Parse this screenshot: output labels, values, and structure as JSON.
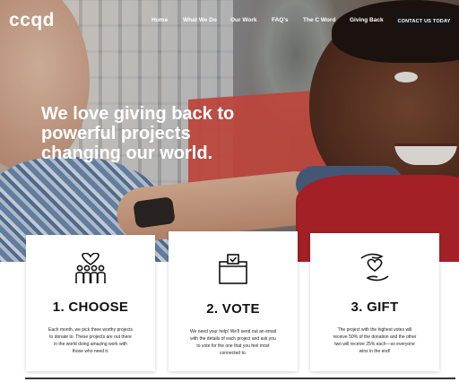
{
  "header": {
    "logo": "ccqd",
    "nav": [
      {
        "label": "Home"
      },
      {
        "label": "What We Do"
      },
      {
        "label": "Our Work"
      },
      {
        "label": "FAQ's"
      },
      {
        "label": "The C Word"
      },
      {
        "label": "Giving Back"
      }
    ],
    "cta_label": "CONTACT US TODAY"
  },
  "hero": {
    "headline": [
      "We love giving back to",
      "powerful projects",
      "changing our world."
    ]
  },
  "steps": [
    {
      "icon": "people-heart-icon",
      "title": "1. CHOOSE",
      "description": [
        "Each month, we pick three worthy projects",
        "to donate to. These projects are out there",
        "in the world doing amazing work with",
        "those who need it."
      ]
    },
    {
      "icon": "ballot-box-icon",
      "title": "2. VOTE",
      "description": [
        "We need your help! We'll send out an email",
        "with the details of each project and ask you",
        "to vote for the one that you feel most",
        "connected to."
      ]
    },
    {
      "icon": "hands-heart-icon",
      "title": "3. GIFT",
      "description": [
        "The project with the highest votes will",
        "receive 50% of the donation and the other",
        "two will receive 25% each—so everyone",
        "wins in the end!"
      ]
    }
  ]
}
